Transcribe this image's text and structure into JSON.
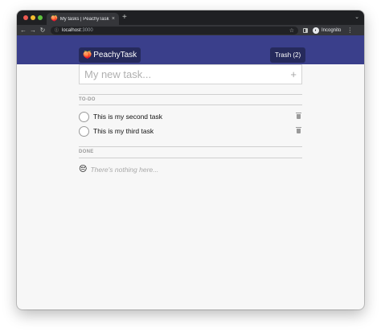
{
  "browser": {
    "tab_title": "My tasks | PeachyTask",
    "tab_favicon": "🍑",
    "tab_close": "×",
    "new_tab": "+",
    "tab_menu": "⌄",
    "nav_back": "←",
    "nav_forward": "→",
    "nav_reload": "↻",
    "url_host": "localhost",
    "url_port": ":3000",
    "info_icon": "ⓘ",
    "star": "☆",
    "incognito_label": "Incognito",
    "more": "⋮"
  },
  "header": {
    "brand_icon": "🍑",
    "brand_name": "PeachyTask",
    "trash_label": "Trash (2)"
  },
  "new_task": {
    "placeholder": "My new task...",
    "value": "",
    "add_icon": "+"
  },
  "todo": {
    "label": "TO-DO",
    "items": [
      {
        "text": "This is my second task"
      },
      {
        "text": "This is my third task"
      }
    ]
  },
  "done": {
    "label": "DONE",
    "empty_emoji": "😔",
    "empty_text": "There's nothing here..."
  },
  "colors": {
    "header_bg": "#3a3f8b",
    "brand_bg": "#262a5c",
    "page_bg": "#f7f7f7"
  }
}
